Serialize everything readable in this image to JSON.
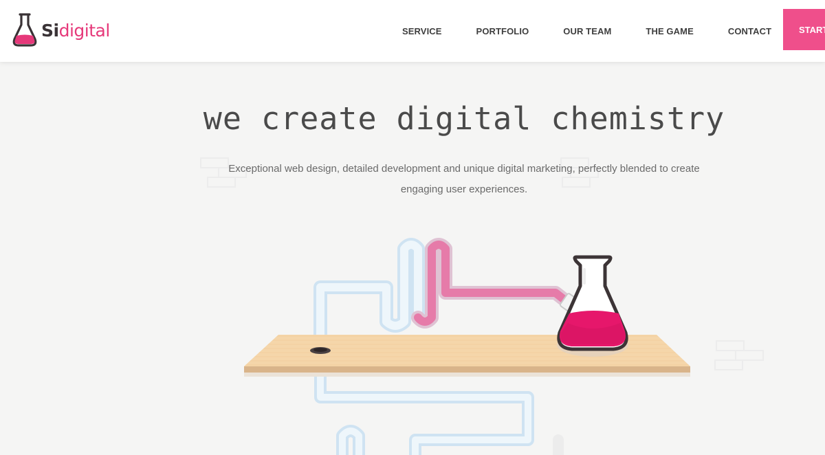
{
  "brand": {
    "name_bold": "Si",
    "name_light": "digital",
    "accent_color": "#e6397a",
    "button_color": "#ef4f8b"
  },
  "nav": {
    "items": [
      {
        "label": "SERVICE"
      },
      {
        "label": "PORTFOLIO"
      },
      {
        "label": "OUR TEAM"
      },
      {
        "label": "THE GAME"
      },
      {
        "label": "CONTACT"
      }
    ],
    "cta_label": "START"
  },
  "hero": {
    "title": "we create digital chemistry",
    "subtitle": "Exceptional web design, detailed development and unique digital marketing, perfectly blended to create engaging user experiences."
  },
  "illustration": {
    "icons": [
      "flask-icon",
      "tube-icon",
      "shelf-icon",
      "drain-hole-icon"
    ]
  }
}
